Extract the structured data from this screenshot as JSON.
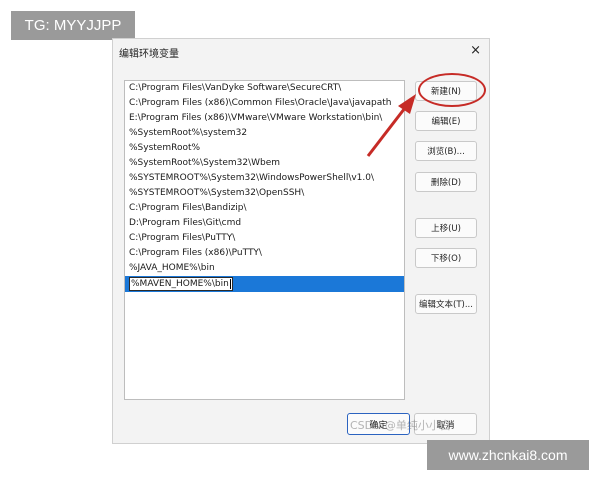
{
  "overlay": {
    "tag_top": "TG: MYYJJPP",
    "tag_bottom": "www.zhcnkai8.com",
    "watermark": "CSDN @单纯小小白"
  },
  "dialog": {
    "title": "编辑环境变量",
    "close_symbol": "×",
    "list": {
      "items": [
        "C:\\Program Files\\VanDyke Software\\SecureCRT\\",
        "C:\\Program Files (x86)\\Common Files\\Oracle\\Java\\javapath",
        "E:\\Program Files (x86)\\VMware\\VMware Workstation\\bin\\",
        "%SystemRoot%\\system32",
        "%SystemRoot%",
        "%SystemRoot%\\System32\\Wbem",
        "%SYSTEMROOT%\\System32\\WindowsPowerShell\\v1.0\\",
        "%SYSTEMROOT%\\System32\\OpenSSH\\",
        "C:\\Program Files\\Bandizip\\",
        "D:\\Program Files\\Git\\cmd",
        "C:\\Program Files\\PuTTY\\",
        "C:\\Program Files (x86)\\PuTTY\\",
        "%JAVA_HOME%\\bin"
      ],
      "editing_value": "%MAVEN_HOME%\\bin"
    },
    "buttons": {
      "new": "新建(N)",
      "edit": "编辑(E)",
      "browse": "浏览(B)...",
      "delete": "删除(D)",
      "move_up": "上移(U)",
      "move_down": "下移(O)",
      "edit_text": "编辑文本(T)...",
      "ok": "确定",
      "cancel": "取消"
    },
    "annotation_color": "#c62b26",
    "selection_color": "#1b78d8"
  }
}
